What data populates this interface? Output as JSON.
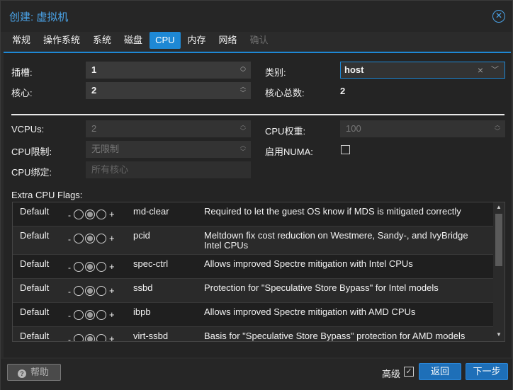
{
  "window": {
    "title": "创建: 虚拟机"
  },
  "tabs": [
    {
      "label": "常规",
      "state": "normal"
    },
    {
      "label": "操作系统",
      "state": "normal"
    },
    {
      "label": "系统",
      "state": "normal"
    },
    {
      "label": "磁盘",
      "state": "normal"
    },
    {
      "label": "CPU",
      "state": "active"
    },
    {
      "label": "内存",
      "state": "normal"
    },
    {
      "label": "网络",
      "state": "normal"
    },
    {
      "label": "确认",
      "state": "disabled"
    }
  ],
  "form": {
    "sockets_label": "插槽:",
    "sockets_value": "1",
    "cores_label": "核心:",
    "cores_value": "2",
    "type_label": "类别:",
    "type_value": "host",
    "total_cores_label": "核心总数:",
    "total_cores_value": "2",
    "vcpus_label": "VCPUs:",
    "vcpus_value": "2",
    "cpu_limit_label": "CPU限制:",
    "cpu_limit_value": "无限制",
    "cpu_affinity_label": "CPU绑定:",
    "cpu_affinity_value": "所有核心",
    "cpu_weight_label": "CPU权重:",
    "cpu_weight_value": "100",
    "numa_label": "启用NUMA:"
  },
  "flags": {
    "title": "Extra CPU Flags:",
    "rows": [
      {
        "state": "Default",
        "minus": "-",
        "plus": "+",
        "flag": "md-clear",
        "desc": "Required to let the guest OS know if MDS is mitigated correctly"
      },
      {
        "state": "Default",
        "minus": "-",
        "plus": "+",
        "flag": "pcid",
        "desc": "Meltdown fix cost reduction on Westmere, Sandy-, and IvyBridge Intel CPUs"
      },
      {
        "state": "Default",
        "minus": "-",
        "plus": "+",
        "flag": "spec-ctrl",
        "desc": "Allows improved Spectre mitigation with Intel CPUs"
      },
      {
        "state": "Default",
        "minus": "-",
        "plus": "+",
        "flag": "ssbd",
        "desc": "Protection for \"Speculative Store Bypass\" for Intel models"
      },
      {
        "state": "Default",
        "minus": "-",
        "plus": "+",
        "flag": "ibpb",
        "desc": "Allows improved Spectre mitigation with AMD CPUs"
      },
      {
        "state": "Default",
        "minus": "-",
        "plus": "+",
        "flag": "virt-ssbd",
        "desc": "Basis for \"Speculative Store Bypass\" protection for AMD models"
      }
    ]
  },
  "footer": {
    "help_label": "帮助",
    "advanced_label": "高级",
    "back_label": "返回",
    "next_label": "下一步"
  },
  "colors": {
    "accent": "#1e88d5",
    "title": "#4aa3e8",
    "background": "#2b2b2b"
  },
  "icons": {
    "close": "close-icon",
    "help": "help-icon",
    "check": "check-icon"
  }
}
